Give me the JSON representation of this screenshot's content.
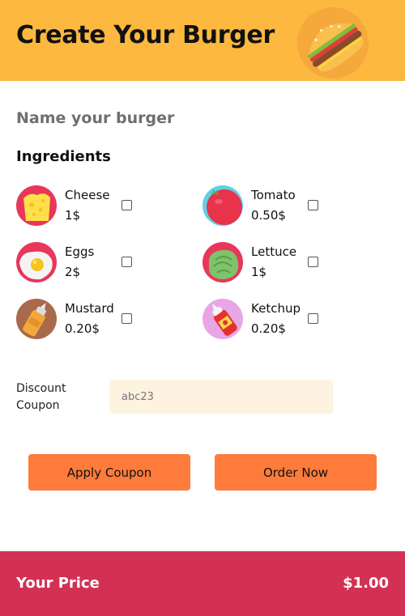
{
  "header": {
    "title": "Create Your Burger",
    "logo_icon": "burger-icon",
    "background": "#fcb83f"
  },
  "name_field": {
    "placeholder": "Name your burger",
    "value": ""
  },
  "ingredients_title": "Ingredients",
  "ingredients": [
    {
      "name": "Cheese",
      "price": "1$",
      "icon": "cheese-icon",
      "checked": false
    },
    {
      "name": "Tomato",
      "price": "0.50$",
      "icon": "tomato-icon",
      "checked": false
    },
    {
      "name": "Eggs",
      "price": "2$",
      "icon": "egg-icon",
      "checked": false
    },
    {
      "name": "Lettuce",
      "price": "1$",
      "icon": "lettuce-icon",
      "checked": false
    },
    {
      "name": "Mustard",
      "price": "0.20$",
      "icon": "mustard-icon",
      "checked": false
    },
    {
      "name": "Ketchup",
      "price": "0.20$",
      "icon": "ketchup-icon",
      "checked": false
    }
  ],
  "coupon": {
    "label": "Discount Coupon",
    "placeholder": "abc23",
    "value": ""
  },
  "buttons": {
    "apply": "Apply Coupon",
    "order": "Order Now"
  },
  "footer": {
    "label": "Your Price",
    "total": "$1.00",
    "background": "#d23153"
  },
  "colors": {
    "accent": "#fe7b3b",
    "input_bg": "#fef3e1"
  }
}
